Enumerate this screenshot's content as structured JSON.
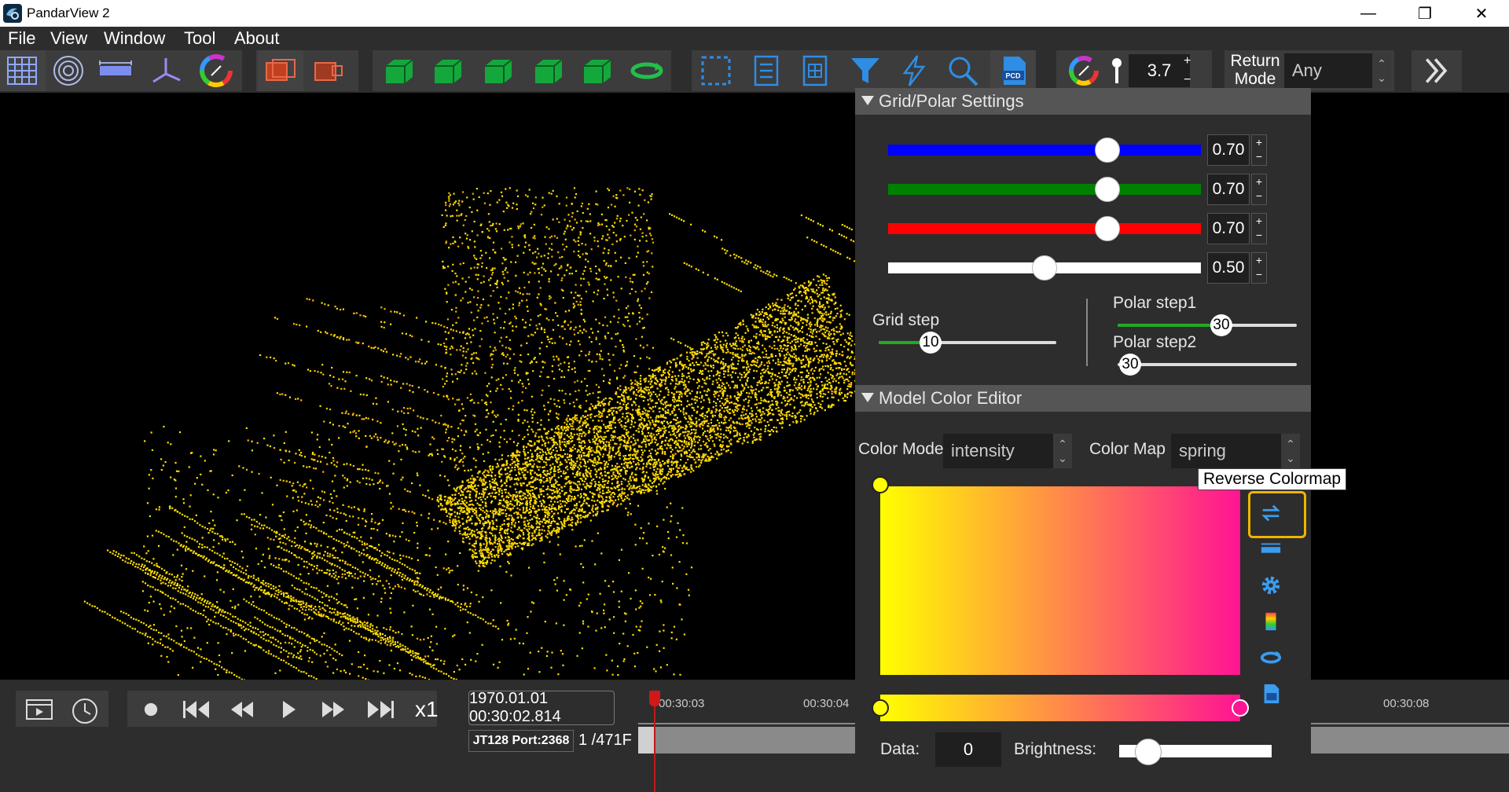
{
  "window": {
    "title": "PandarView 2",
    "controls": {
      "minimize": "—",
      "maximize": "❐",
      "close": "✕"
    }
  },
  "menu": [
    "File",
    "View",
    "Window",
    "Tool",
    "About"
  ],
  "toolbar": {
    "buttons": [
      {
        "name": "grid-view-icon"
      },
      {
        "name": "polar-view-icon"
      },
      {
        "name": "ruler-icon"
      },
      {
        "name": "axis-icon"
      },
      {
        "name": "color-wheel-icon"
      },
      {
        "name": "frame-overlay-icon"
      },
      {
        "name": "frame-overlay-alt-icon"
      },
      {
        "name": "cube-view-1-icon"
      },
      {
        "name": "cube-view-2-icon"
      },
      {
        "name": "cube-view-3-icon"
      },
      {
        "name": "cube-view-4-icon"
      },
      {
        "name": "cube-view-5-icon"
      },
      {
        "name": "rotate-view-icon"
      },
      {
        "name": "select-region-icon"
      },
      {
        "name": "document-list-icon"
      },
      {
        "name": "grid-document-icon"
      },
      {
        "name": "filter-icon"
      },
      {
        "name": "lightning-icon"
      },
      {
        "name": "search-icon"
      },
      {
        "name": "pcd-file-icon"
      }
    ],
    "pcd_label": "PCD",
    "point_size": "3.7",
    "spin_plus": "+",
    "spin_minus": "−",
    "return_mode_label_1": "Return",
    "return_mode_label_2": "Mode",
    "return_mode_value": "Any",
    "spin_arrows": "⌃⌄"
  },
  "grid_polar": {
    "header": "Grid/Polar Settings",
    "sliders": [
      {
        "color": "#0000ff",
        "value": "0.70",
        "level": 0.7
      },
      {
        "color": "#008000",
        "value": "0.70",
        "level": 0.7
      },
      {
        "color": "#ff0000",
        "value": "0.70",
        "level": 0.7
      },
      {
        "color": "#ffffff",
        "value": "0.50",
        "level": 0.5
      }
    ],
    "grid_step_label": "Grid step",
    "grid_step_value": "10",
    "polar_step1_label": "Polar step1",
    "polar_step1_value": "30",
    "polar_step2_label": "Polar step2",
    "polar_step2_value": "30"
  },
  "color_editor": {
    "header": "Model Color Editor",
    "color_mode_label": "Color Mode",
    "color_mode_value": "intensity",
    "color_map_label": "Color Map",
    "color_map_value": "spring",
    "gradient": {
      "start": "#ffff00",
      "end": "#ff1493"
    },
    "tooltip": "Reverse Colormap",
    "side_icons": [
      "reverse-colormap-icon",
      "range-icon",
      "gear-icon",
      "palette-icon",
      "loop-icon",
      "file-icon"
    ],
    "data_label": "Data:",
    "data_value": "0",
    "brightness_label": "Brightness:",
    "brightness_level": 0.1
  },
  "player": {
    "speed": "x1",
    "timestamp": "1970.01.01 00:30:02.814",
    "port": "JT128 Port:2368",
    "frames": "1 /471F",
    "ticks": [
      "00:30:03",
      "00:30:04",
      "00:30:08"
    ]
  },
  "colors": {
    "background": "#000000",
    "panel": "#2d2d2d",
    "accent_green": "#22aa22",
    "highlight": "#f0b400",
    "point_cloud": "#ffe000"
  }
}
